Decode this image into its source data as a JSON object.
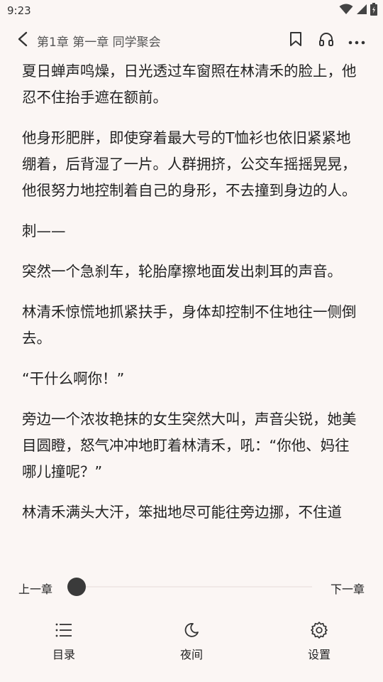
{
  "status_bar": {
    "time": "9:23"
  },
  "header": {
    "chapter_title": "第1章 第一章 同学聚会"
  },
  "content": {
    "paragraphs": [
      "夏日蝉声鸣燥，日光透过车窗照在林清禾的脸上，他忍不住抬手遮在额前。",
      "他身形肥胖，即使穿着最大号的T恤衫也依旧紧紧地绷着，后背湿了一片。人群拥挤，公交车摇摇晃晃，他很努力地控制着自己的身形，不去撞到身边的人。",
      "刺——",
      "突然一个急刹车，轮胎摩擦地面发出刺耳的声音。",
      "林清禾惊慌地抓紧扶手，身体却控制不住地往一侧倒去。",
      "“干什么啊你！”",
      "旁边一个浓妆艳抹的女生突然大叫，声音尖锐，她美目圆瞪，怒气冲冲地盯着林清禾，吼：“你他、妈往哪儿撞呢？”",
      "林清禾满头大汗，笨拙地尽可能往旁边挪，不住道"
    ]
  },
  "bottom_bar": {
    "prev_chapter": "上一章",
    "next_chapter": "下一章",
    "progress": 0,
    "nav": {
      "toc": "目录",
      "night": "夜间",
      "settings": "设置"
    }
  },
  "icons": {
    "wifi": "wifi-icon",
    "signal": "signal-icon",
    "battery": "battery-icon",
    "back": "chevron-left-icon",
    "bookmark": "bookmark-icon",
    "listen": "headphones-icon",
    "more": "more-horizontal-icon",
    "toc": "list-icon",
    "night": "moon-icon",
    "settings": "gear-icon"
  }
}
